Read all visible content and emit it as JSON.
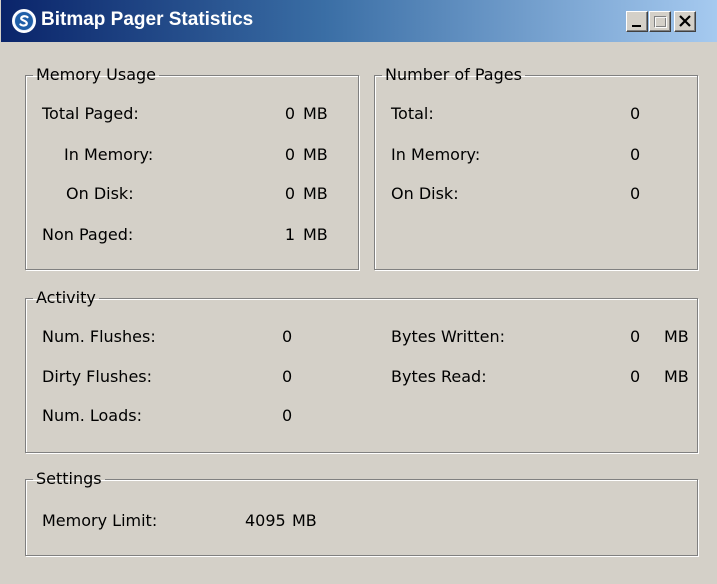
{
  "window": {
    "title": "Bitmap Pager Statistics",
    "icon": "3ds-max-logo-icon",
    "controls": [
      "minimize-icon",
      "maximize-icon",
      "close-icon"
    ],
    "colors": {
      "face": "#d4d0c8",
      "title_start": "#0a246a",
      "title_end": "#a6caf0"
    }
  },
  "memory_usage": {
    "title": "Memory Usage",
    "total_paged": {
      "label": "Total Paged:",
      "value": "0",
      "unit": "MB"
    },
    "in_memory": {
      "label": "In Memory:",
      "value": "0",
      "unit": "MB"
    },
    "on_disk": {
      "label": "On Disk:",
      "value": "0",
      "unit": "MB"
    },
    "non_paged": {
      "label": "Non Paged:",
      "value": "1",
      "unit": "MB"
    }
  },
  "number_of_pages": {
    "title": "Number of Pages",
    "total": {
      "label": "Total:",
      "value": "0"
    },
    "in_memory": {
      "label": "In Memory:",
      "value": "0"
    },
    "on_disk": {
      "label": "On Disk:",
      "value": "0"
    }
  },
  "activity": {
    "title": "Activity",
    "num_flushes": {
      "label": "Num. Flushes:",
      "value": "0"
    },
    "dirty_flushes": {
      "label": "Dirty Flushes:",
      "value": "0"
    },
    "num_loads": {
      "label": "Num. Loads:",
      "value": "0"
    },
    "bytes_written": {
      "label": "Bytes Written:",
      "value": "0",
      "unit": "MB"
    },
    "bytes_read": {
      "label": "Bytes Read:",
      "value": "0",
      "unit": "MB"
    }
  },
  "settings": {
    "title": "Settings",
    "memory_limit": {
      "label": "Memory Limit:",
      "value": "4095",
      "unit": "MB"
    }
  }
}
